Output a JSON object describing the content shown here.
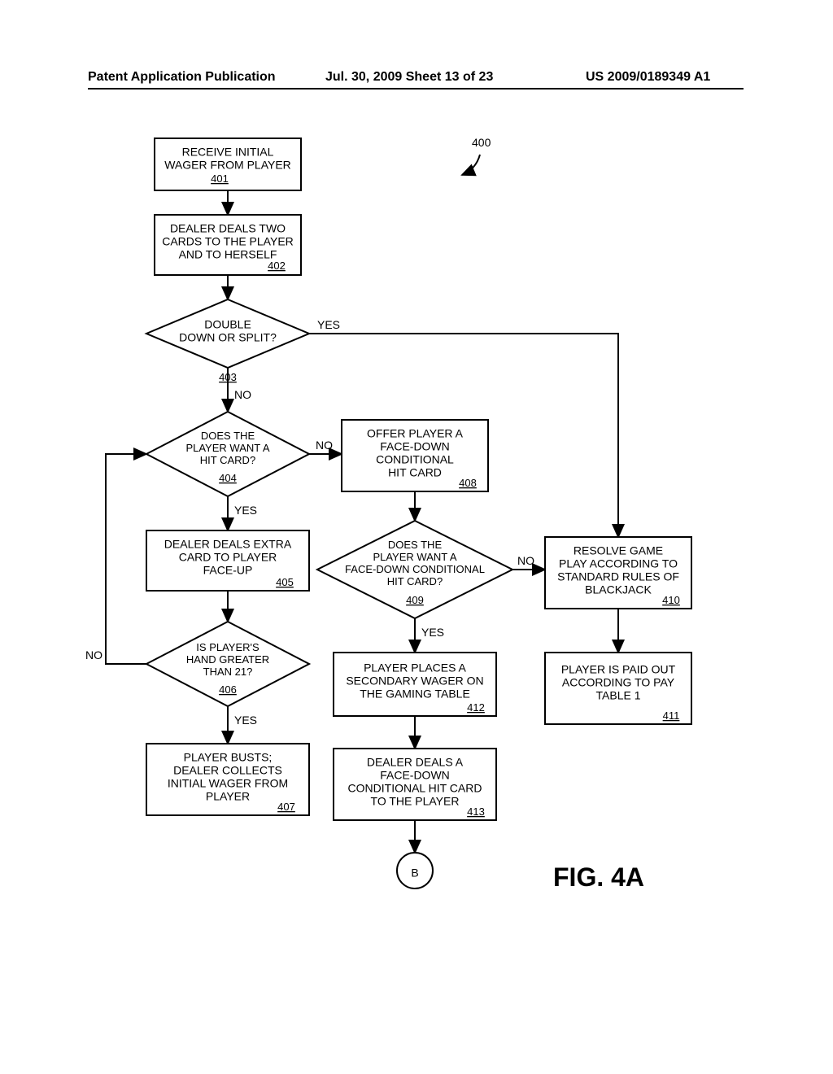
{
  "header": {
    "left": "Patent Application Publication",
    "center": "Jul. 30, 2009  Sheet 13 of 23",
    "right": "US 2009/0189349 A1"
  },
  "figureLabel": "FIG. 4A",
  "refNum": "400",
  "labels": {
    "yes": "YES",
    "no": "NO"
  },
  "connector": "B",
  "nodes": {
    "n401": {
      "lines": [
        "RECEIVE INITIAL",
        "WAGER FROM PLAYER"
      ],
      "ref": "401"
    },
    "n402": {
      "lines": [
        "DEALER DEALS TWO",
        "CARDS TO THE PLAYER",
        "AND TO HERSELF"
      ],
      "ref": "402"
    },
    "n403": {
      "lines": [
        "DOUBLE",
        "DOWN OR SPLIT?"
      ],
      "ref": "403"
    },
    "n404": {
      "lines": [
        "DOES THE",
        "PLAYER WANT A",
        "HIT CARD?"
      ],
      "ref": "404"
    },
    "n405": {
      "lines": [
        "DEALER DEALS EXTRA",
        "CARD TO PLAYER",
        "FACE-UP"
      ],
      "ref": "405"
    },
    "n406": {
      "lines": [
        "IS PLAYER'S",
        "HAND GREATER",
        "THAN 21?"
      ],
      "ref": "406"
    },
    "n407": {
      "lines": [
        "PLAYER BUSTS;",
        "DEALER COLLECTS",
        "INITIAL WAGER FROM",
        "PLAYER"
      ],
      "ref": "407"
    },
    "n408": {
      "lines": [
        "OFFER PLAYER A",
        "FACE-DOWN",
        "CONDITIONAL",
        "HIT CARD"
      ],
      "ref": "408"
    },
    "n409": {
      "lines": [
        "DOES THE",
        "PLAYER WANT A",
        "FACE-DOWN CONDITIONAL",
        "HIT CARD?"
      ],
      "ref": "409"
    },
    "n410": {
      "lines": [
        "RESOLVE GAME",
        "PLAY ACCORDING TO",
        "STANDARD RULES OF",
        "BLACKJACK"
      ],
      "ref": "410"
    },
    "n411": {
      "lines": [
        "PLAYER IS PAID OUT",
        "ACCORDING TO PAY",
        "TABLE 1"
      ],
      "ref": "411"
    },
    "n412": {
      "lines": [
        "PLAYER PLACES A",
        "SECONDARY WAGER ON",
        "THE GAMING TABLE"
      ],
      "ref": "412"
    },
    "n413": {
      "lines": [
        "DEALER DEALS A",
        "FACE-DOWN",
        "CONDITIONAL HIT CARD",
        "TO THE PLAYER"
      ],
      "ref": "413"
    }
  }
}
